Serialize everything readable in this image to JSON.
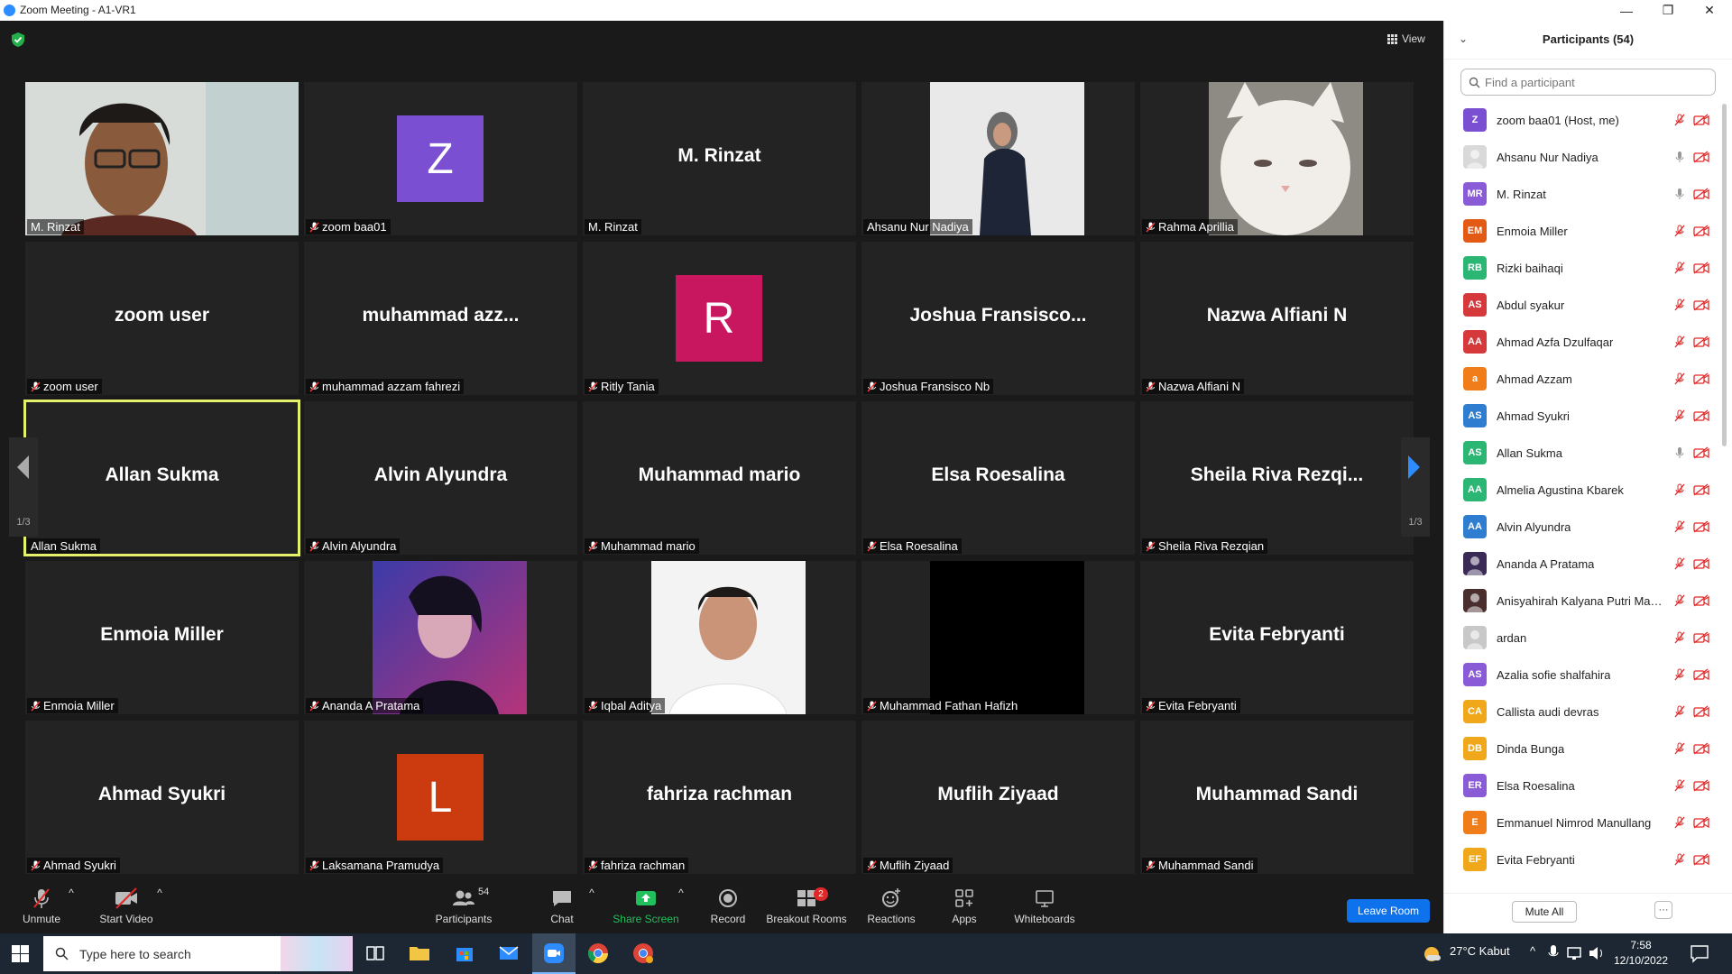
{
  "window": {
    "title": "Zoom Meeting - A1-VR1"
  },
  "view_label": "View",
  "tiles": [
    {
      "label": "M. Rinzat",
      "muted": false,
      "kind": "fullphoto",
      "photo": "man-glasses"
    },
    {
      "label": "zoom baa01",
      "muted": true,
      "kind": "avatar",
      "letter": "Z",
      "color": "#7b4fd1"
    },
    {
      "label": "M. Rinzat",
      "muted": false,
      "kind": "text",
      "big": "M. Rinzat"
    },
    {
      "label": "Ahsanu Nur Nadiya",
      "muted": false,
      "kind": "photo",
      "photo": "woman-hijab"
    },
    {
      "label": "Rahma Aprillia",
      "muted": true,
      "kind": "photo",
      "photo": "white-cat"
    },
    {
      "label": "zoom user",
      "muted": true,
      "kind": "text",
      "big": "zoom user"
    },
    {
      "label": "muhammad azzam fahrezi",
      "muted": true,
      "kind": "text",
      "big": "muhammad  azz..."
    },
    {
      "label": "Ritly Tania",
      "muted": true,
      "kind": "avatar",
      "letter": "R",
      "color": "#c8175f"
    },
    {
      "label": "Joshua Fransisco Nb",
      "muted": true,
      "kind": "text",
      "big": "Joshua  Fransisco..."
    },
    {
      "label": "Nazwa Alfiani N",
      "muted": true,
      "kind": "text",
      "big": "Nazwa Alfiani N"
    },
    {
      "label": "Allan Sukma",
      "muted": false,
      "kind": "text",
      "big": "Allan Sukma",
      "active": true
    },
    {
      "label": "Alvin Alyundra",
      "muted": true,
      "kind": "text",
      "big": "Alvin Alyundra"
    },
    {
      "label": "Muhammad mario",
      "muted": true,
      "kind": "text",
      "big": "Muhammad mario"
    },
    {
      "label": "Elsa Roesalina",
      "muted": true,
      "kind": "text",
      "big": "Elsa Roesalina"
    },
    {
      "label": "Sheila Riva Rezqian",
      "muted": true,
      "kind": "text",
      "big": "Sheila  Riva  Rezqi..."
    },
    {
      "label": "Enmoia Miller",
      "muted": true,
      "kind": "text",
      "big": "Enmoia Miller"
    },
    {
      "label": "Ananda A Pratama",
      "muted": true,
      "kind": "photo",
      "photo": "neon-woman"
    },
    {
      "label": "Iqbal Aditya",
      "muted": true,
      "kind": "photo",
      "photo": "man-white-shirt"
    },
    {
      "label": "Muhammad Fathan Hafizh",
      "muted": true,
      "kind": "photo",
      "photo": "black"
    },
    {
      "label": "Evita Febryanti",
      "muted": true,
      "kind": "text",
      "big": "Evita Febryanti"
    },
    {
      "label": "Ahmad Syukri",
      "muted": true,
      "kind": "text",
      "big": "Ahmad Syukri"
    },
    {
      "label": "Laksamana Pramudya",
      "muted": true,
      "kind": "avatar",
      "letter": "L",
      "color": "#cc3a0f"
    },
    {
      "label": "fahriza rachman",
      "muted": true,
      "kind": "text",
      "big": "fahriza rachman"
    },
    {
      "label": "Muflih Ziyaad",
      "muted": true,
      "kind": "text",
      "big": "Muflih Ziyaad"
    },
    {
      "label": "Muhammad Sandi",
      "muted": true,
      "kind": "text",
      "big": "Muhammad Sandi"
    }
  ],
  "pager": {
    "left": "1/3",
    "right": "1/3"
  },
  "toolbar": {
    "unmute": "Unmute",
    "start_video": "Start Video",
    "participants": "Participants",
    "participants_count": "54",
    "chat": "Chat",
    "share_screen": "Share Screen",
    "record": "Record",
    "breakout_rooms": "Breakout Rooms",
    "breakout_badge": "2",
    "reactions": "Reactions",
    "apps": "Apps",
    "whiteboards": "Whiteboards",
    "leave_room": "Leave Room"
  },
  "panel": {
    "title": "Participants (54)",
    "search_placeholder": "Find a participant",
    "mute_all": "Mute All",
    "more": "···",
    "participants": [
      {
        "initials": "Z",
        "name": "zoom baa01 (Host, me)",
        "color": "#7b4fd1",
        "mic": "off"
      },
      {
        "initials": "",
        "name": "Ahsanu Nur Nadiya",
        "color": "#d9d9d9",
        "mic": "on",
        "photo": true
      },
      {
        "initials": "MR",
        "name": "M. Rinzat",
        "color": "#8a5bd6",
        "mic": "on"
      },
      {
        "initials": "EM",
        "name": "Enmoia Miller",
        "color": "#e25a14",
        "mic": "off"
      },
      {
        "initials": "RB",
        "name": "Rizki baihaqi",
        "color": "#2bb673",
        "mic": "off"
      },
      {
        "initials": "AS",
        "name": "Abdul syakur",
        "color": "#d6393c",
        "mic": "off"
      },
      {
        "initials": "AA",
        "name": "Ahmad Azfa Dzulfaqar",
        "color": "#d6393c",
        "mic": "off"
      },
      {
        "initials": "a",
        "name": "Ahmad Azzam",
        "color": "#f07c1a",
        "mic": "off"
      },
      {
        "initials": "AS",
        "name": "Ahmad Syukri",
        "color": "#2f7dd1",
        "mic": "off"
      },
      {
        "initials": "AS",
        "name": "Allan Sukma",
        "color": "#2bb673",
        "mic": "on"
      },
      {
        "initials": "AA",
        "name": "Almelia Agustina Kbarek",
        "color": "#2bb673",
        "mic": "off"
      },
      {
        "initials": "AA",
        "name": "Alvin Alyundra",
        "color": "#2f7dd1",
        "mic": "off"
      },
      {
        "initials": "",
        "name": "Ananda A Pratama",
        "color": "#3b2a55",
        "mic": "off",
        "photo": true
      },
      {
        "initials": "",
        "name": "Anisyahirah Kalyana Putri Maul...",
        "color": "#4a2e2e",
        "mic": "off",
        "photo": true
      },
      {
        "initials": "",
        "name": "ardan",
        "color": "#c8c8c8",
        "mic": "off",
        "photo": true
      },
      {
        "initials": "AS",
        "name": "Azalia sofie shalfahira",
        "color": "#8a5bd6",
        "mic": "off"
      },
      {
        "initials": "CA",
        "name": "Callista audi devras",
        "color": "#f0a81a",
        "mic": "off"
      },
      {
        "initials": "DB",
        "name": "Dinda Bunga",
        "color": "#f0a81a",
        "mic": "off"
      },
      {
        "initials": "ER",
        "name": "Elsa Roesalina",
        "color": "#8a5bd6",
        "mic": "off"
      },
      {
        "initials": "E",
        "name": "Emmanuel Nimrod Manullang",
        "color": "#f07c1a",
        "mic": "off"
      },
      {
        "initials": "EF",
        "name": "Evita Febryanti",
        "color": "#f0a81a",
        "mic": "off"
      },
      {
        "initials": "",
        "name": "",
        "color": "#2bb673",
        "mic": "off"
      }
    ]
  },
  "taskbar": {
    "search_placeholder": "Type here to search",
    "weather": "27°C  Kabut",
    "time": "7:58",
    "date": "12/10/2022"
  }
}
